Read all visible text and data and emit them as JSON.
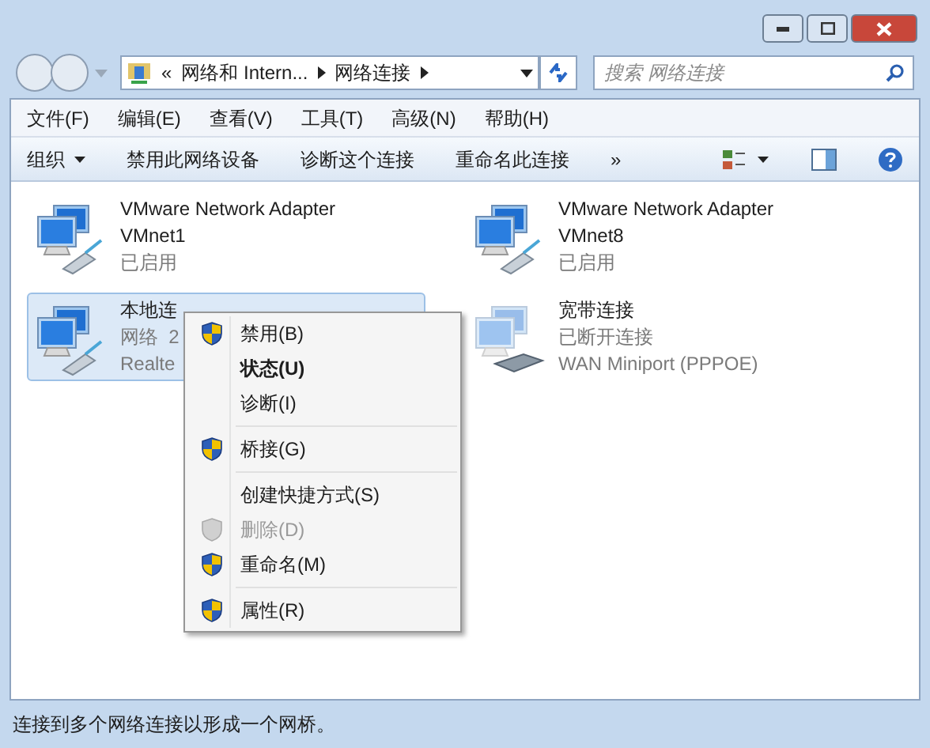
{
  "window": {
    "controls": [
      {
        "kind": "minimize"
      },
      {
        "kind": "restore"
      },
      {
        "kind": "close"
      }
    ]
  },
  "address_bar": {
    "crumbs": [
      "«",
      "网络和 Intern...",
      "网络连接"
    ],
    "search_placeholder": "搜索 网络连接"
  },
  "menu_bar": [
    "文件(F)",
    "编辑(E)",
    "查看(V)",
    "工具(T)",
    "高级(N)",
    "帮助(H)"
  ],
  "command_bar": [
    {
      "label": "组织",
      "dropdown": true
    },
    {
      "label": "禁用此网络设备",
      "dropdown": false
    },
    {
      "label": "诊断这个连接",
      "dropdown": false
    },
    {
      "label": "重命名此连接",
      "dropdown": false
    },
    {
      "label": "»",
      "dropdown": false
    }
  ],
  "connections": [
    {
      "name": "VMware Network Adapter VMnet1",
      "status": "已启用",
      "selected": false,
      "connected": true
    },
    {
      "name": "VMware Network Adapter VMnet8",
      "status": "已启用",
      "selected": false,
      "connected": true
    },
    {
      "name": "本地连",
      "status": "网络  2",
      "device": "Realte",
      "selected": true,
      "connected": true
    },
    {
      "name": "宽带连接",
      "status": "已断开连接",
      "device": "WAN Miniport (PPPOE)",
      "selected": false,
      "connected": false
    }
  ],
  "context_menu": [
    {
      "kind": "item",
      "label": "禁用(B)",
      "shield": true,
      "bold": false,
      "disabled": false
    },
    {
      "kind": "item",
      "label": "状态(U)",
      "shield": false,
      "bold": true,
      "disabled": false
    },
    {
      "kind": "item",
      "label": "诊断(I)",
      "shield": false,
      "bold": false,
      "disabled": false
    },
    {
      "kind": "separator"
    },
    {
      "kind": "item",
      "label": "桥接(G)",
      "shield": true,
      "bold": false,
      "disabled": false
    },
    {
      "kind": "separator"
    },
    {
      "kind": "item",
      "label": "创建快捷方式(S)",
      "shield": false,
      "bold": false,
      "disabled": false
    },
    {
      "kind": "item",
      "label": "删除(D)",
      "shield": true,
      "bold": false,
      "disabled": true
    },
    {
      "kind": "item",
      "label": "重命名(M)",
      "shield": true,
      "bold": false,
      "disabled": false
    },
    {
      "kind": "separator"
    },
    {
      "kind": "item",
      "label": "属性(R)",
      "shield": true,
      "bold": false,
      "disabled": false
    }
  ],
  "status_bar": "连接到多个网络连接以形成一个网桥。"
}
